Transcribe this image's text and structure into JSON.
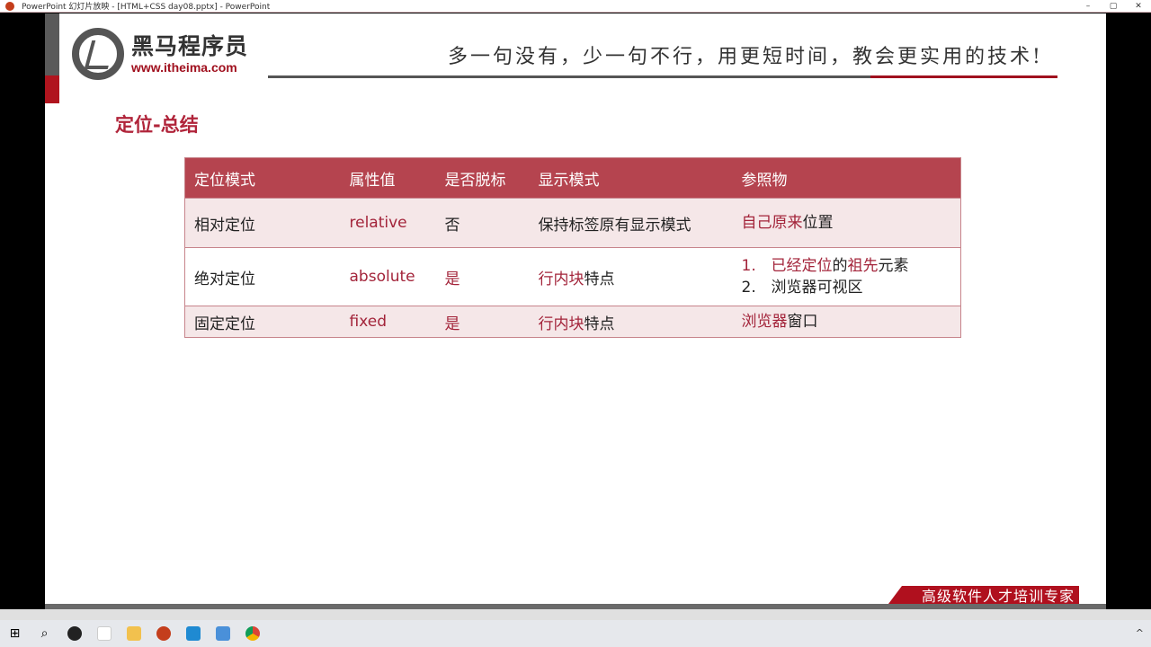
{
  "window": {
    "title": "PowerPoint 幻灯片放映 - [HTML+CSS day08.pptx] - PowerPoint",
    "controls": [
      "–",
      "▢",
      "✕"
    ]
  },
  "slide": {
    "logo": {
      "name": "黑马程序员",
      "url": "www.itheima.com"
    },
    "slogan": "多一句没有，少一句不行，用更短时间，教会更实用的技术!",
    "title": "定位-总结",
    "table": {
      "headers": [
        "定位模式",
        "属性值",
        "是否脱标",
        "显示模式",
        "参照物"
      ],
      "rows": [
        {
          "mode": "相对定位",
          "value": "relative",
          "out": "否",
          "out_hl": false,
          "display": [
            {
              "t": "保持标签原有显示模式",
              "hl": false
            }
          ],
          "ref": [
            [
              {
                "t": "自己原来",
                "hl": true
              },
              {
                "t": "位置",
                "hl": false
              }
            ]
          ]
        },
        {
          "mode": "绝对定位",
          "value": "absolute",
          "out": "是",
          "out_hl": true,
          "display": [
            {
              "t": "行内块",
              "hl": true
            },
            {
              "t": "特点",
              "hl": false
            }
          ],
          "ref": [
            [
              {
                "t": "1.",
                "hl": true,
                "num": true
              },
              {
                "t": "已经定位",
                "hl": true
              },
              {
                "t": "的",
                "hl": false
              },
              {
                "t": "祖先",
                "hl": true
              },
              {
                "t": "元素",
                "hl": false
              }
            ],
            [
              {
                "t": "2.",
                "hl": false,
                "num": true
              },
              {
                "t": "浏览器可视区",
                "hl": false
              }
            ]
          ]
        },
        {
          "mode": "固定定位",
          "value": "fixed",
          "out": "是",
          "out_hl": true,
          "display": [
            {
              "t": "行内块",
              "hl": true
            },
            {
              "t": "特点",
              "hl": false
            }
          ],
          "ref": [
            [
              {
                "t": "浏览器",
                "hl": true
              },
              {
                "t": "窗口",
                "hl": false
              }
            ]
          ]
        }
      ]
    },
    "banner": "高级软件人才培训专家"
  },
  "taskbar": {
    "items": [
      "start-icon",
      "search-icon",
      "obs-icon",
      "typora-icon",
      "file-explorer-icon",
      "powerpoint-icon",
      "vscode-icon",
      "app-icon",
      "chrome-icon"
    ],
    "tray": [
      "^"
    ]
  },
  "colors": {
    "accent": "#b5444f",
    "highlight": "#a3243a"
  }
}
